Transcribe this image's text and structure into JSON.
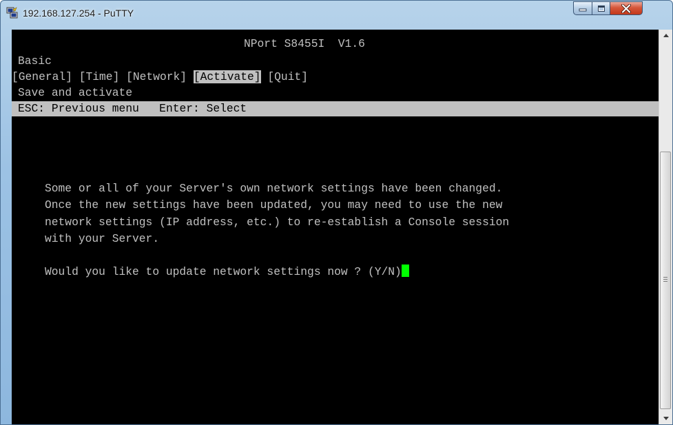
{
  "window": {
    "title": "192.168.127.254 - PuTTY"
  },
  "terminal": {
    "header": "NPort S8455I  V1.6",
    "section": "Basic",
    "menu": {
      "general": "[General]",
      "time": "[Time]",
      "network": "[Network]",
      "activate": "[Activate]",
      "quit": "[Quit]",
      "selected": "[Activate]"
    },
    "subtitle": "Save and activate",
    "status_bar": "ESC: Previous menu   Enter: Select",
    "message_lines": [
      "Some or all of your Server's own network settings have been changed.",
      "Once the new settings have been updated, you may need to use the new",
      "network settings (IP address, etc.) to re-establish a Console session",
      "with your Server."
    ],
    "prompt": "Would you like to update network settings now ? (Y/N)"
  },
  "colors": {
    "terminal_bg": "#000000",
    "terminal_text": "#c0c0c0",
    "highlight_bg": "#c0c0c0",
    "cursor": "#00ff00",
    "close_button": "#c94a2e"
  },
  "icons": {
    "app": "putty-icon",
    "minimize": "minimize-icon",
    "maximize": "maximize-icon",
    "close": "close-icon",
    "scroll_up": "scroll-up-arrow-icon",
    "scroll_down": "scroll-down-arrow-icon"
  }
}
